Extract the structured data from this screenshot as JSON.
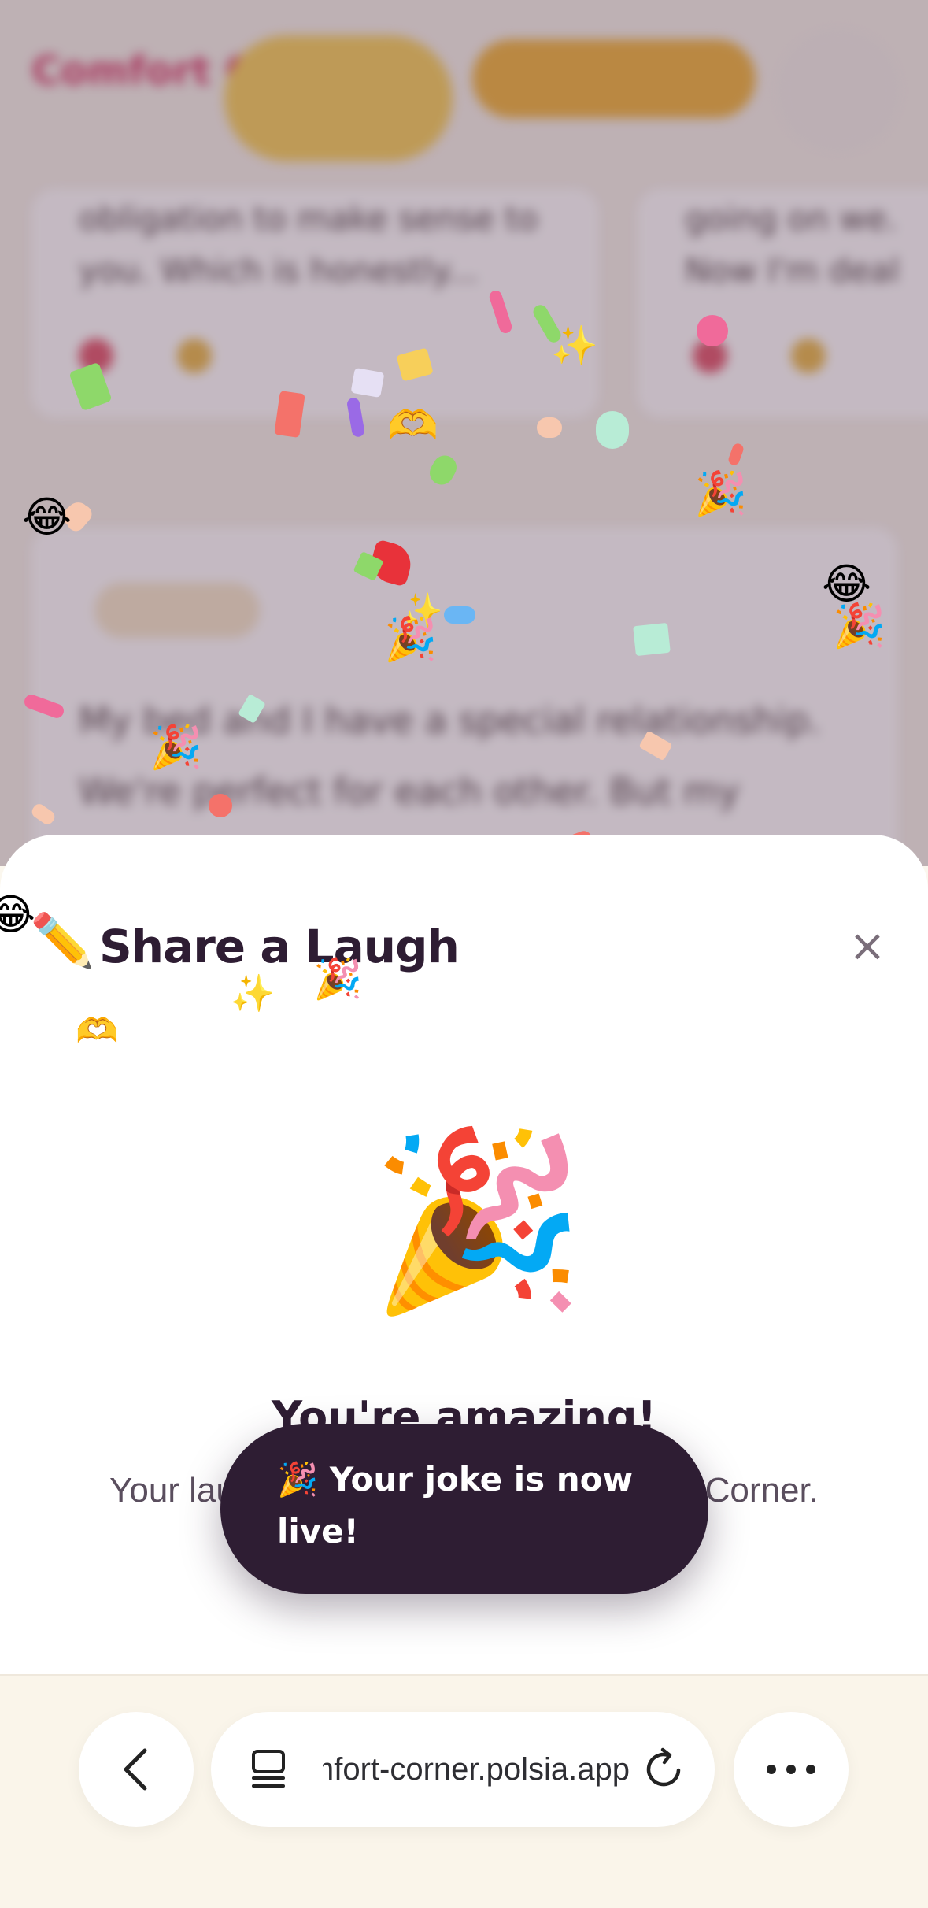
{
  "background_page": {
    "logo": "Comfort Corner",
    "card_left_text": "obligation to make sense to you. Which is honestly...",
    "card_right_text": "going on we. Now I'm deal",
    "post_text": "My bed and I have a special relationship. We're perfect for each other. But my"
  },
  "sheet": {
    "title_icon": "✏️",
    "title": "Share a Laugh",
    "close_icon": "×",
    "celebration_emoji": "🎉",
    "heading": "You're amazing!",
    "subtext": "Your laugh is now brightening Comfort Corner."
  },
  "toast": {
    "text": "🎉 Your joke is now live!"
  },
  "browser": {
    "url": "comfort-corner.polsia.app",
    "back_icon": "chevron-left-icon",
    "tabs_icon": "tabs-icon",
    "reload_icon": "reload-icon",
    "more_icon": "more-icon"
  },
  "colors": {
    "sheet_bg": "#ffffff",
    "toast_bg": "#2e1d33",
    "title_color": "#2e1d33",
    "browser_bar_bg": "#faf5ea"
  }
}
